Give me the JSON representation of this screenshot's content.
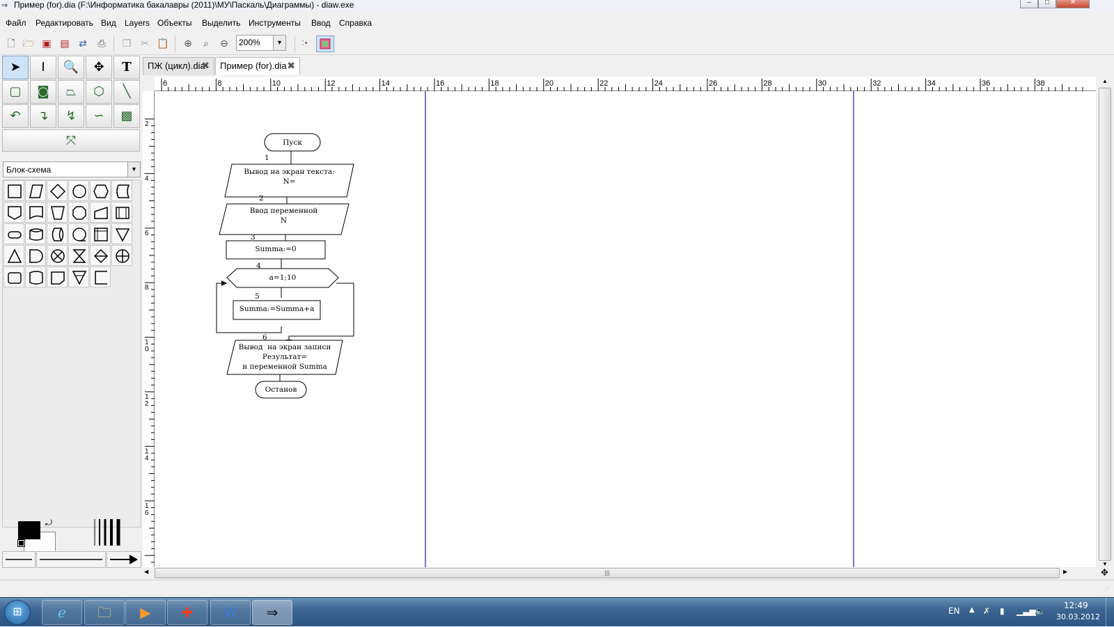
{
  "window": {
    "title": "Пример (for).dia (F:\\Информатика бакалавры (2011)\\МУ\\Паскаль\\Диаграммы) - diaw.exe",
    "controls": {
      "minimize": "‒",
      "maximize": "□",
      "close": "✕"
    }
  },
  "menu": [
    "Файл",
    "Редактировать",
    "Вид",
    "Layers",
    "Объекты",
    "Выделить",
    "Инструменты",
    "Ввод",
    "Справка"
  ],
  "toolbar": {
    "zoom_value": "200%",
    "icons": [
      "new-icon",
      "open-icon",
      "save-icon",
      "save-as-icon",
      "export-icon",
      "print-icon",
      "copy-icon",
      "cut-icon",
      "paste-icon",
      "zoom-in-icon",
      "zoom-fit-icon",
      "zoom-out-icon"
    ]
  },
  "tabs": [
    {
      "label": "ПЖ (цикл).dia",
      "active": false
    },
    {
      "label": "Пример (for).dia",
      "active": true
    }
  ],
  "toolbox": {
    "sheet": "Блок-схема",
    "colors": {
      "foreground": "#000000",
      "background": "#ffffff"
    }
  },
  "ruler": {
    "h_labels": [
      "6",
      "8",
      "10",
      "12",
      "14",
      "16",
      "18",
      "20",
      "22",
      "24",
      "26",
      "28",
      "30",
      "32",
      "34",
      "36",
      "38"
    ],
    "v_labels": [
      "2",
      "4",
      "6",
      "8",
      "10",
      "12",
      "14",
      "16"
    ]
  },
  "flowchart": {
    "start": "Пуск",
    "step1_num": "1",
    "step1_line1": "Вывод на экран текста:",
    "step1_line2": "N=",
    "step2_num": "2",
    "step2_line1": "Ввод переменной",
    "step2_line2": "N",
    "step3_num": "3",
    "step3": "Summa:=0",
    "step4_num": "4",
    "step4": "a=1;10",
    "step5_num": "5",
    "step5": "Summa:=Summa+a",
    "step6_num": "6",
    "step6_line1": "Вывод  на экран записи",
    "step6_line2": "Результат=",
    "step6_line3": "и переменной Summa",
    "end": "Останов"
  },
  "taskbar": {
    "lang": "EN",
    "time": "12:49",
    "date": "30.03.2012"
  }
}
